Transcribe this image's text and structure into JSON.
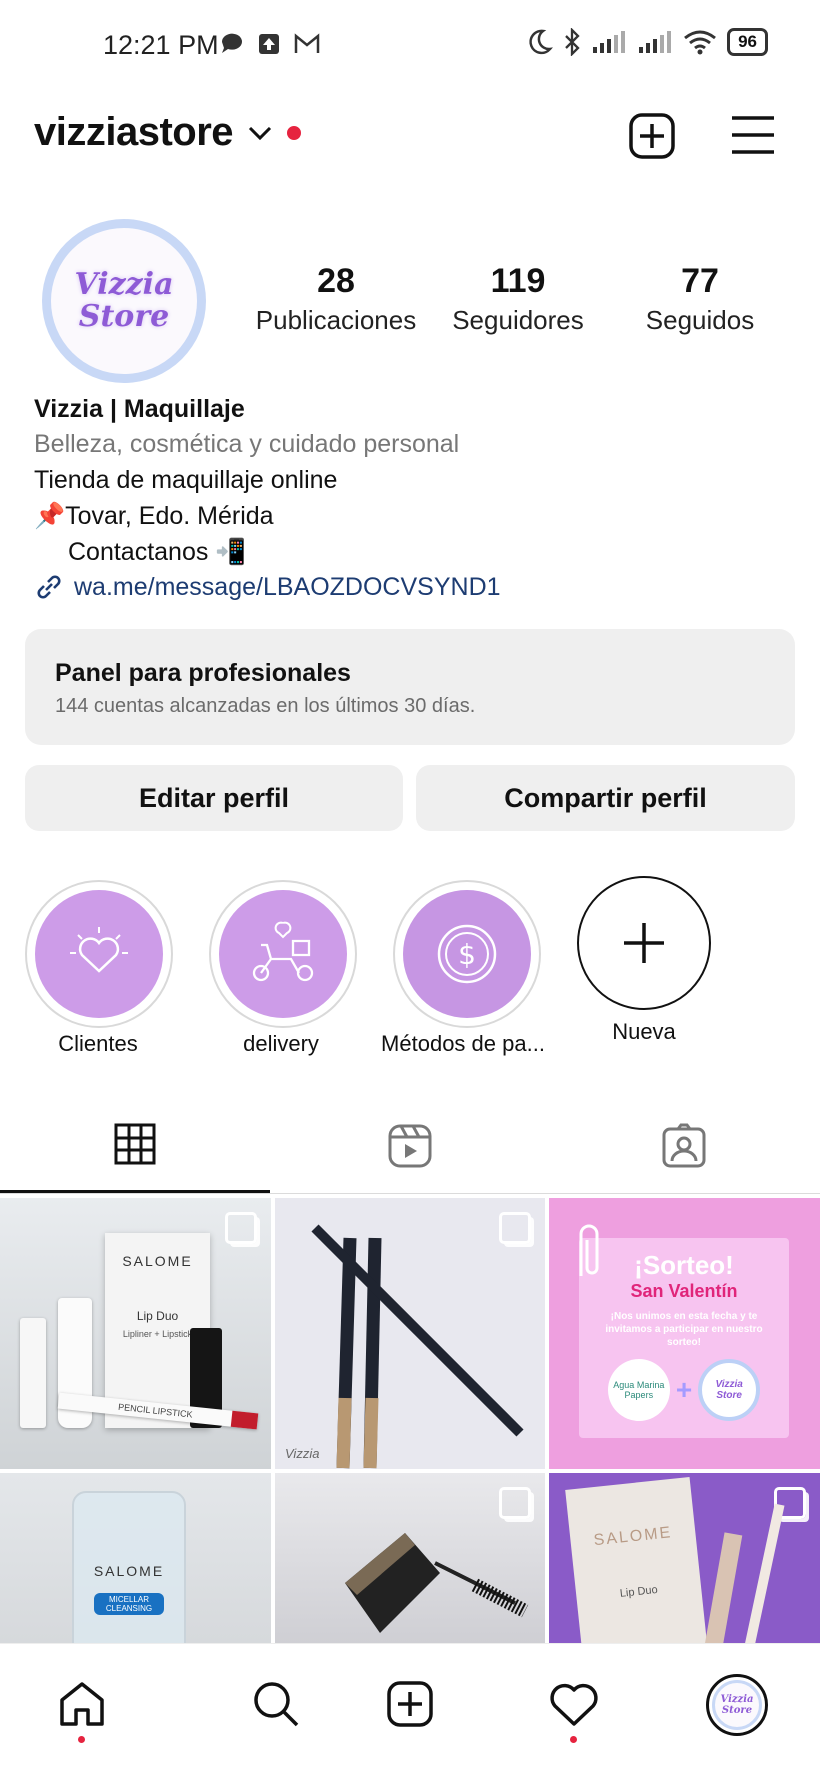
{
  "status_bar": {
    "time": "12:21 PM",
    "battery": "96"
  },
  "header": {
    "username": "vizziastore"
  },
  "profile": {
    "avatar_line1": "Vizzia",
    "avatar_line2": "Store",
    "stats": [
      {
        "value": "28",
        "label": "Publicaciones"
      },
      {
        "value": "119",
        "label": "Seguidores"
      },
      {
        "value": "77",
        "label": "Seguidos"
      }
    ],
    "name": "Vizzia | Maquillaje",
    "category": "Belleza, cosmética y cuidado personal",
    "bio_line1": "Tienda de maquillaje online",
    "bio_line2": "📌Tovar, Edo. Mérida",
    "bio_line3": "Contactanos 📲",
    "link": "wa.me/message/LBAOZDOCVSYND1"
  },
  "panel": {
    "title": "Panel para profesionales",
    "subtitle": "144 cuentas alcanzadas en los últimos 30 días."
  },
  "buttons": {
    "edit": "Editar perfil",
    "share": "Compartir perfil"
  },
  "highlights": [
    {
      "label": "Clientes",
      "icon": "heart-icon"
    },
    {
      "label": "delivery",
      "icon": "scooter-icon"
    },
    {
      "label": "Métodos de pa...",
      "icon": "dollar-icon"
    },
    {
      "label": "Nueva",
      "icon": "plus-icon"
    }
  ],
  "posts": {
    "tile1_brand": "SALOME",
    "tile1_box": "Lip Duo",
    "tile1_box_sub": "Lipliner + Lipstick",
    "tile1_pencil": "PENCIL LIPSTICK",
    "tile2_watermark": "Vizzia",
    "tile3_title": "¡Sorteo!",
    "tile3_subtitle": "San Valentín",
    "tile3_text": "¡Nos unimos en esta fecha y te invitamos a participar en nuestro sorteo!",
    "tile3_logo1": "Agua Marina Papers",
    "tile3_logo2": "Vizzia Store",
    "tile4_brand": "SALOME",
    "tile4_label": "MICELLAR CLEANSING",
    "tile6_brand": "SALOME",
    "tile6_box": "Lip Duo"
  },
  "colors": {
    "accent_red": "#e6233f",
    "highlight_purple": "#cd9ce8",
    "link_blue": "#1d3c72"
  }
}
